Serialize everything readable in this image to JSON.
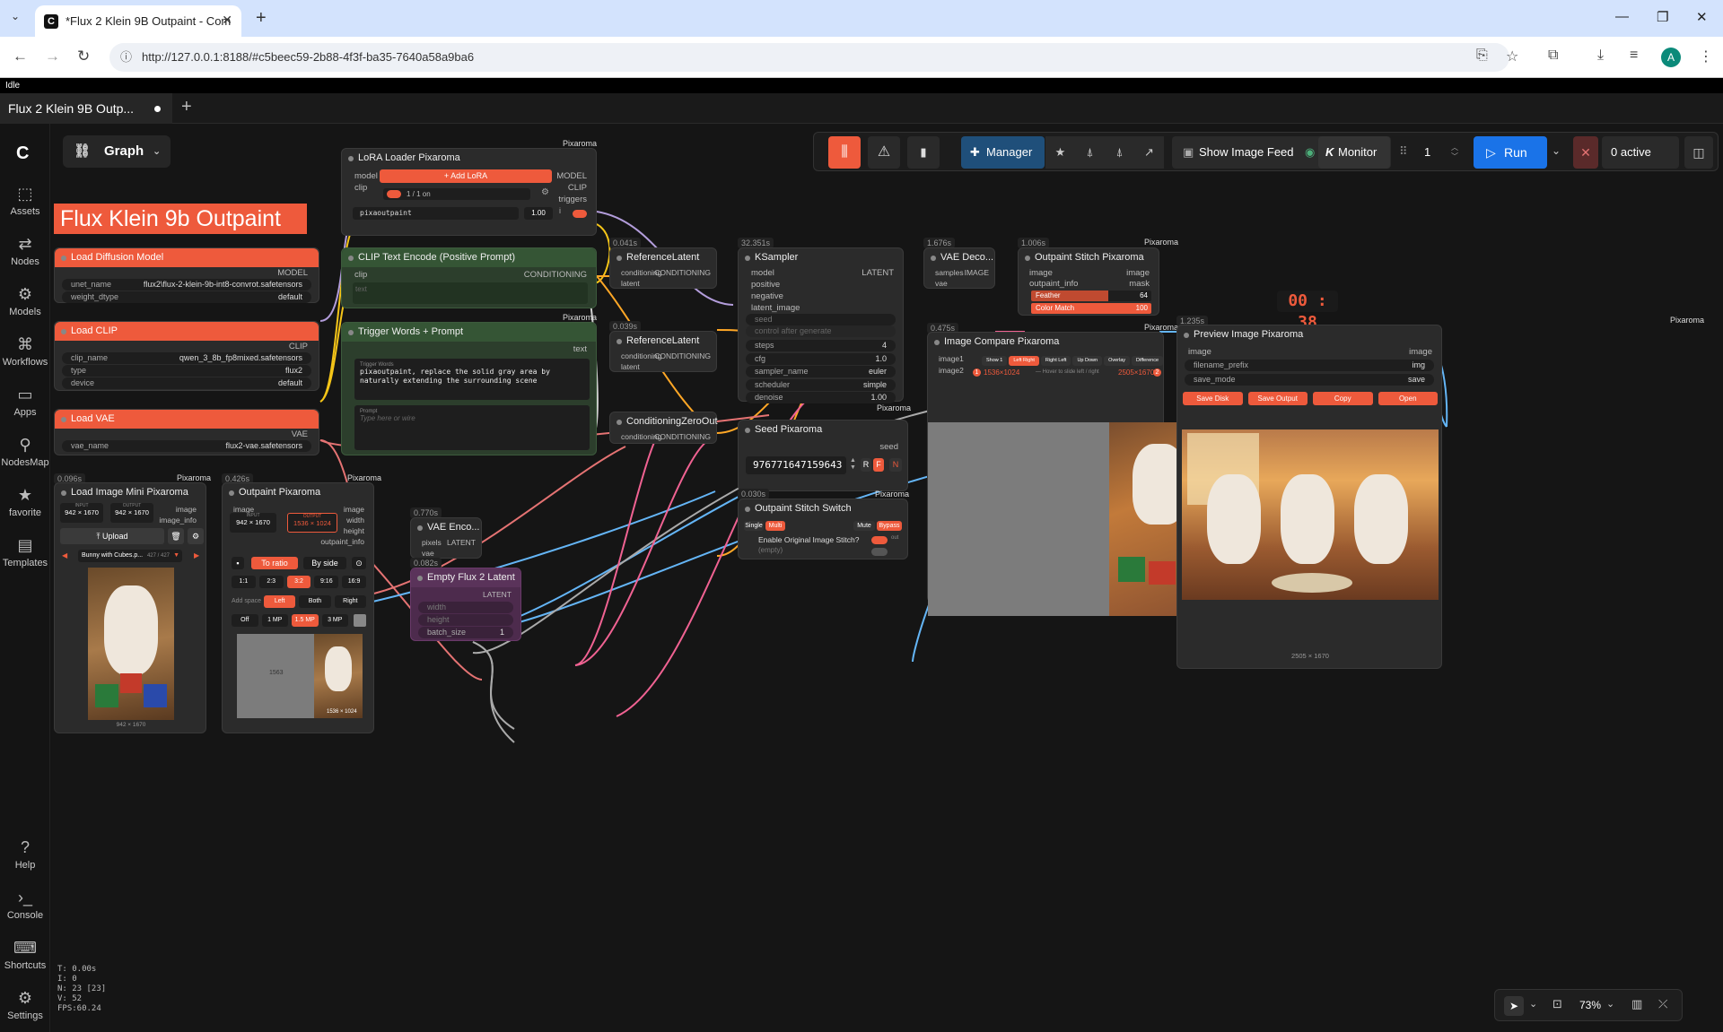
{
  "browser": {
    "tab_title": "*Flux 2 Klein 9B Outpaint - Com",
    "url": "http://127.0.0.1:8188/#c5beec59-2b88-4f3f-ba35-7640a58a9ba6",
    "profile_initial": "A"
  },
  "app": {
    "status": "Idle",
    "workflow_tab": "Flux 2 Klein 9B Outp...",
    "graph_label": "Graph",
    "sidebar": [
      {
        "label": "Assets",
        "icon": "assets-icon"
      },
      {
        "label": "Nodes",
        "icon": "nodes-icon"
      },
      {
        "label": "Models",
        "icon": "models-icon"
      },
      {
        "label": "Workflows",
        "icon": "workflows-icon"
      },
      {
        "label": "Apps",
        "icon": "apps-icon"
      },
      {
        "label": "NodesMap",
        "icon": "nodesmap-icon"
      },
      {
        "label": "favorite",
        "icon": "star-icon"
      },
      {
        "label": "Templates",
        "icon": "templates-icon"
      }
    ],
    "sidebar_bottom": [
      {
        "label": "Help",
        "icon": "help-icon"
      },
      {
        "label": "Console",
        "icon": "console-icon"
      },
      {
        "label": "Shortcuts",
        "icon": "keyboard-icon"
      },
      {
        "label": "Settings",
        "icon": "gear-icon"
      }
    ],
    "toolbar": {
      "manager": "Manager",
      "show_image_feed": "Show Image Feed",
      "monitor": "Monitor",
      "batch": "1",
      "run": "Run",
      "active": "0 active"
    },
    "stats": [
      "T: 0.00s",
      "I: 0",
      "N: 23 [23]",
      "V: 52",
      "FPS:60.24"
    ],
    "zoom": "73%",
    "timer": "00 : 38"
  },
  "canvas": {
    "title_note": "Flux Klein 9b Outpaint",
    "nodes": {
      "lora": {
        "title": "LoRA Loader Pixaroma",
        "tag": "Pixaroma",
        "in": [
          "model",
          "clip"
        ],
        "out": [
          "MODEL",
          "CLIP",
          "triggers"
        ],
        "add": "+ Add LoRA",
        "count": "1 / 1 on",
        "lora_name": "pixaoutpaint",
        "strength": "1.00"
      },
      "diffusion": {
        "title": "Load Diffusion Model",
        "out": "MODEL",
        "unet_label": "unet_name",
        "unet_value": "flux2\\flux-2-klein-9b-int8-convrot.safetensors",
        "dtype_label": "weight_dtype",
        "dtype_value": "default"
      },
      "clip": {
        "title": "Load CLIP",
        "out": "CLIP",
        "clip_label": "clip_name",
        "clip_value": "qwen_3_8b_fp8mixed.safetensors",
        "type_label": "type",
        "type_value": "flux2",
        "device_label": "device",
        "device_value": "default"
      },
      "vae": {
        "title": "Load VAE",
        "out": "VAE",
        "vae_label": "vae_name",
        "vae_value": "flux2-vae.safetensors"
      },
      "clip_text": {
        "title": "CLIP Text Encode (Positive Prompt)",
        "in": "clip",
        "out": "CONDITIONING",
        "placeholder": "text"
      },
      "trigger": {
        "title": "Trigger Words + Prompt",
        "tag": "Pixaroma",
        "out": "text",
        "tw_label": "Trigger Words",
        "tw_value": "pixaoutpaint, replace the solid gray area by naturally extending the surrounding scene",
        "prompt_label": "Prompt",
        "prompt_placeholder": "Type here or wire"
      },
      "ref1": {
        "title": "ReferenceLatent",
        "time": "0.041s",
        "in": [
          "conditioning",
          "latent"
        ],
        "out": "CONDITIONING"
      },
      "ref2": {
        "title": "ReferenceLatent",
        "time": "0.039s",
        "in": [
          "conditioning",
          "latent"
        ],
        "out": "CONDITIONING"
      },
      "czero": {
        "title": "ConditioningZeroOut",
        "in": "conditioning",
        "out": "CONDITIONING"
      },
      "ksampler": {
        "title": "KSampler",
        "time": "32.351s",
        "in": [
          "model",
          "positive",
          "negative",
          "latent_image",
          "seed"
        ],
        "out": "LATENT",
        "control": "control after generate",
        "widgets": [
          {
            "l": "steps",
            "v": "4"
          },
          {
            "l": "cfg",
            "v": "1.0"
          },
          {
            "l": "sampler_name",
            "v": "euler"
          },
          {
            "l": "scheduler",
            "v": "simple"
          },
          {
            "l": "denoise",
            "v": "1.00"
          }
        ]
      },
      "vaedec": {
        "title": "VAE Deco...",
        "time": "1.676s",
        "in": [
          "samples",
          "vae"
        ],
        "out": "IMAGE"
      },
      "stitch": {
        "title": "Outpaint Stitch Pixaroma",
        "tag": "Pixaroma",
        "time": "1.006s",
        "in": [
          "image",
          "outpaint_info"
        ],
        "out": [
          "image",
          "mask"
        ],
        "feather_label": "Feather",
        "feather": "64",
        "cm_label": "Color Match",
        "cm": "100"
      },
      "compare": {
        "title": "Image Compare Pixaroma",
        "tag": "Pixaroma",
        "time": "0.475s",
        "in": [
          "image1",
          "image2"
        ],
        "modes": [
          "Show 1",
          "Left Right",
          "Right Left",
          "Up Down",
          "Overlay",
          "Difference"
        ],
        "size1": "1536×1024",
        "hint": "— Hover to slide left / right",
        "size2": "2505×1670",
        "n1": "1",
        "n2": "2"
      },
      "preview": {
        "title": "Preview Image Pixaroma",
        "tag": "Pixaroma",
        "time": "1.235s",
        "in": "image",
        "out": "image",
        "prefix_label": "filename_prefix",
        "prefix_value": "img",
        "save_label": "save_mode",
        "save_value": "save",
        "buttons": [
          "Save Disk",
          "Save Output",
          "Copy",
          "Open"
        ],
        "dims": "2505 × 1670"
      },
      "seed": {
        "title": "Seed Pixaroma",
        "tag": "Pixaroma",
        "out": "seed",
        "value": "976771647159643",
        "btns": [
          "R",
          "F",
          "N"
        ]
      },
      "switch": {
        "title": "Outpaint Stitch Switch",
        "tag": "Pixaroma",
        "time": "0.030s",
        "modes": [
          "Single",
          "Multi"
        ],
        "modes2": [
          "Mute",
          "Bypass"
        ],
        "toggle_label": "Enable Original Image Stitch?",
        "empty": "(empty)",
        "out_label": "out"
      },
      "loadimg": {
        "title": "Load Image Mini Pixaroma",
        "tag": "Pixaroma",
        "time": "0.096s",
        "out": [
          "image",
          "image_info"
        ],
        "input_label": "INPUT",
        "input": "942 × 1670",
        "output_label": "OUTPUT",
        "output": "942 × 1670",
        "upload": "Upload",
        "file": "Bunny with Cubes.p...",
        "file_idx": "427 / 427",
        "dims": "942 × 1670"
      },
      "outpaint": {
        "title": "Outpaint Pixaroma",
        "tag": "Pixaroma",
        "time": "0.426s",
        "in": "image",
        "out": [
          "image",
          "width",
          "height",
          "outpaint_info"
        ],
        "input_label": "INPUT",
        "input": "942 × 1670",
        "output_label": "OUTPUT",
        "output": "1536 × 1024",
        "mode1": "To ratio",
        "mode2": "By side",
        "ratios": [
          "1:1",
          "2:3",
          "3:2",
          "9:16",
          "16:9"
        ],
        "space_label": "Add space",
        "space": [
          "Left",
          "Both",
          "Right"
        ],
        "mp": [
          "Off",
          "1 MP",
          "1.5 MP",
          "3 MP"
        ],
        "pad": "1563",
        "dims": "1536 × 1024"
      },
      "vaeenc": {
        "title": "VAE Enco...",
        "time": "0.770s",
        "in": [
          "pixels",
          "vae"
        ],
        "out": "LATENT"
      },
      "empty": {
        "title": "Empty Flux 2 Latent",
        "time": "0.082s",
        "out": "LATENT",
        "w": "width",
        "h": "height",
        "batch_label": "batch_size",
        "batch": "1"
      }
    }
  }
}
